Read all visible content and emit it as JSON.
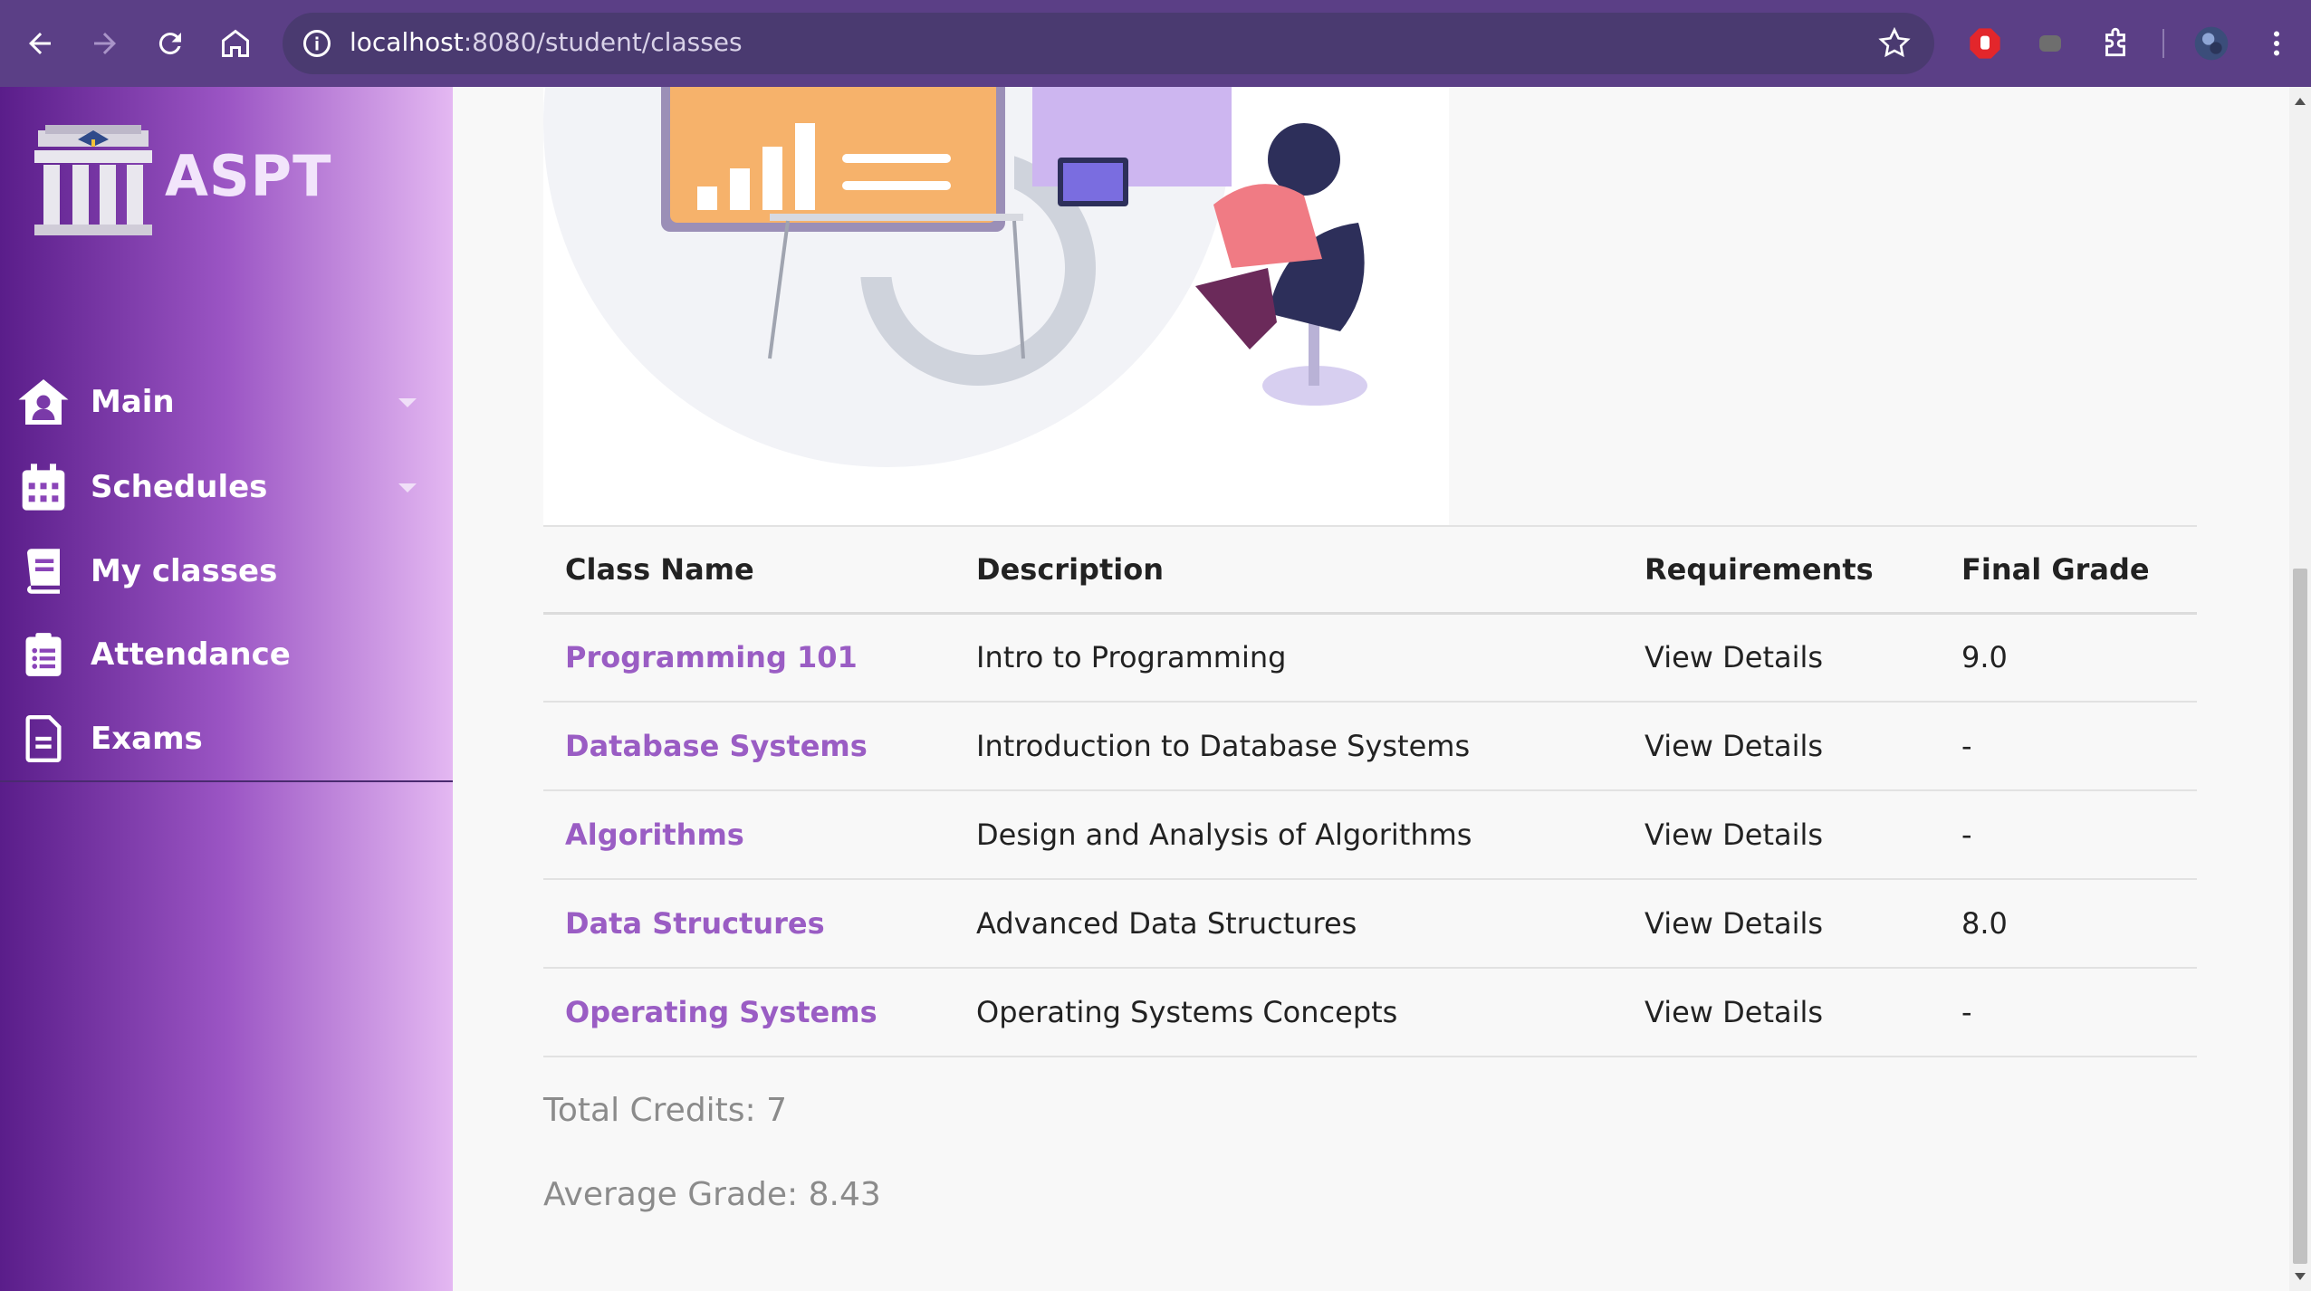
{
  "browser": {
    "url_host": "localhost",
    "url_rest": ":8080/student/classes"
  },
  "sidebar": {
    "logo_text": "ASPT",
    "items": [
      {
        "label": "Main",
        "icon": "home-user-icon",
        "dropdown": true
      },
      {
        "label": "Schedules",
        "icon": "calendar-icon",
        "dropdown": true
      },
      {
        "label": "My classes",
        "icon": "book-icon",
        "dropdown": false
      },
      {
        "label": "Attendance",
        "icon": "clipboard-list-icon",
        "dropdown": false
      },
      {
        "label": "Exams",
        "icon": "file-icon",
        "dropdown": false
      }
    ]
  },
  "table": {
    "headers": [
      "Class Name",
      "Description",
      "Requirements",
      "Final Grade"
    ],
    "rows": [
      {
        "name": "Programming 101",
        "description": "Intro to Programming",
        "requirements": "View Details",
        "grade": "9.0"
      },
      {
        "name": "Database Systems",
        "description": "Introduction to Database Systems",
        "requirements": "View Details",
        "grade": "-"
      },
      {
        "name": "Algorithms",
        "description": "Design and Analysis of Algorithms",
        "requirements": "View Details",
        "grade": "-"
      },
      {
        "name": "Data Structures",
        "description": "Advanced Data Structures",
        "requirements": "View Details",
        "grade": "8.0"
      },
      {
        "name": "Operating Systems",
        "description": "Operating Systems Concepts",
        "requirements": "View Details",
        "grade": "-"
      }
    ]
  },
  "summary": {
    "total_credits": "Total Credits: 7",
    "average_grade": "Average Grade: 8.43"
  },
  "colors": {
    "browser_bar": "#5b3f86",
    "sidebar_start": "#5a1d8a",
    "sidebar_end": "#e4b8f2",
    "class_link": "#9a5dc4"
  }
}
